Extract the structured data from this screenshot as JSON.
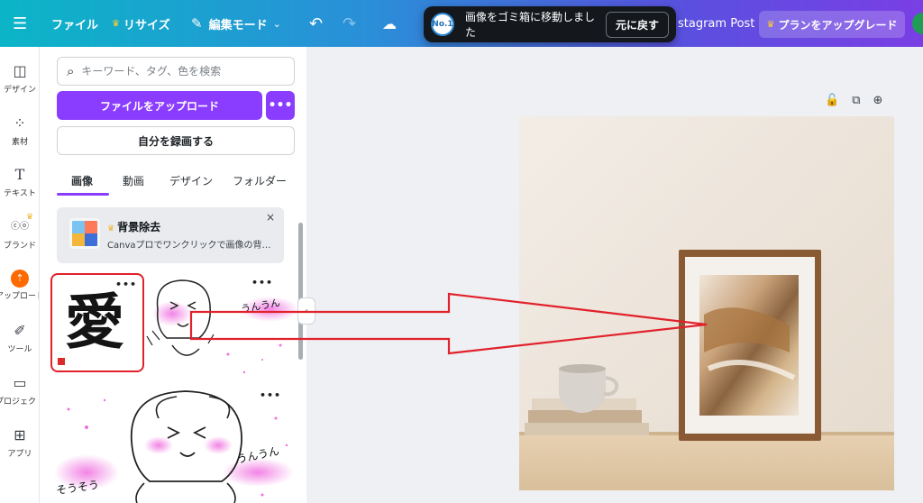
{
  "topbar": {
    "menu_icon": "hamburger-icon",
    "file": "ファイル",
    "resize": "リサイズ",
    "edit_mode": "編集モード",
    "design_title": "stagram Post",
    "upgrade": "プランをアップグレード"
  },
  "toast": {
    "logo_text": "No.1",
    "message": "画像をゴミ箱に移動しました",
    "undo": "元に戻す"
  },
  "rail": {
    "items": [
      {
        "label": "デザイン",
        "icon": "layout-icon"
      },
      {
        "label": "素材",
        "icon": "shapes-icon"
      },
      {
        "label": "テキスト",
        "icon": "text-icon"
      },
      {
        "label": "ブランド",
        "icon": "brand-icon"
      },
      {
        "label": "アップロード",
        "icon": "upload-icon"
      },
      {
        "label": "ツール",
        "icon": "draw-icon"
      },
      {
        "label": "プロジェクト",
        "icon": "folder-icon"
      },
      {
        "label": "アプリ",
        "icon": "apps-icon"
      }
    ]
  },
  "panel": {
    "search_placeholder": "キーワード、タグ、色を検索",
    "upload_button": "ファイルをアップロード",
    "more_button": "•••",
    "record_button": "自分を録画する",
    "tabs": [
      "画像",
      "動画",
      "デザイン",
      "フォルダー"
    ],
    "promo": {
      "title": "背景除去",
      "text": "Canvaプロでワンクリックで画像の背景...",
      "close": "×"
    },
    "thumb_kanji": "愛",
    "thumb_dots": "•••",
    "sticker1_text": "うんうん",
    "sticker2_text_left": "そうそう",
    "sticker2_text_right": "うんうん"
  },
  "colors": {
    "accent": "#8b3dff",
    "highlight": "#e1212b",
    "upload_orange": "#ff6a00"
  }
}
